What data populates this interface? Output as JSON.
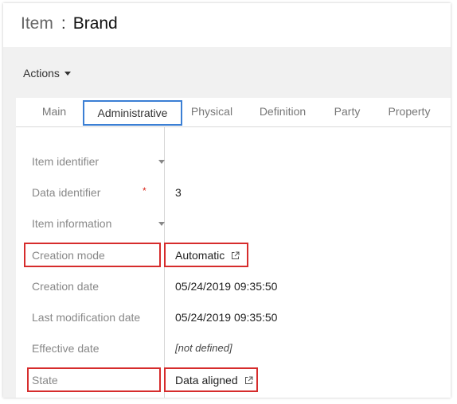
{
  "header": {
    "entity": "Item",
    "separator": ":",
    "name": "Brand"
  },
  "actions": {
    "label": "Actions"
  },
  "tabs": [
    {
      "label": "Main",
      "active": false
    },
    {
      "label": "Administrative",
      "active": true
    },
    {
      "label": "Physical",
      "active": false
    },
    {
      "label": "Definition",
      "active": false
    },
    {
      "label": "Party",
      "active": false
    },
    {
      "label": "Property",
      "active": false
    }
  ],
  "fields": {
    "item_identifier": {
      "label": "Item identifier"
    },
    "data_identifier": {
      "label": "Data identifier",
      "required_mark": "*",
      "value": "3"
    },
    "item_information": {
      "label": "Item information"
    },
    "creation_mode": {
      "label": "Creation mode",
      "value": "Automatic"
    },
    "creation_date": {
      "label": "Creation date",
      "value": "05/24/2019 09:35:50"
    },
    "last_modification_date": {
      "label": "Last modification date",
      "value": "05/24/2019 09:35:50"
    },
    "effective_date": {
      "label": "Effective date",
      "value": "[not defined]"
    },
    "state": {
      "label": "State",
      "value": "Data aligned"
    }
  },
  "colors": {
    "highlight": "#d62c2c",
    "active_tab_border": "#3b7fd4",
    "required": "#d9271c"
  }
}
